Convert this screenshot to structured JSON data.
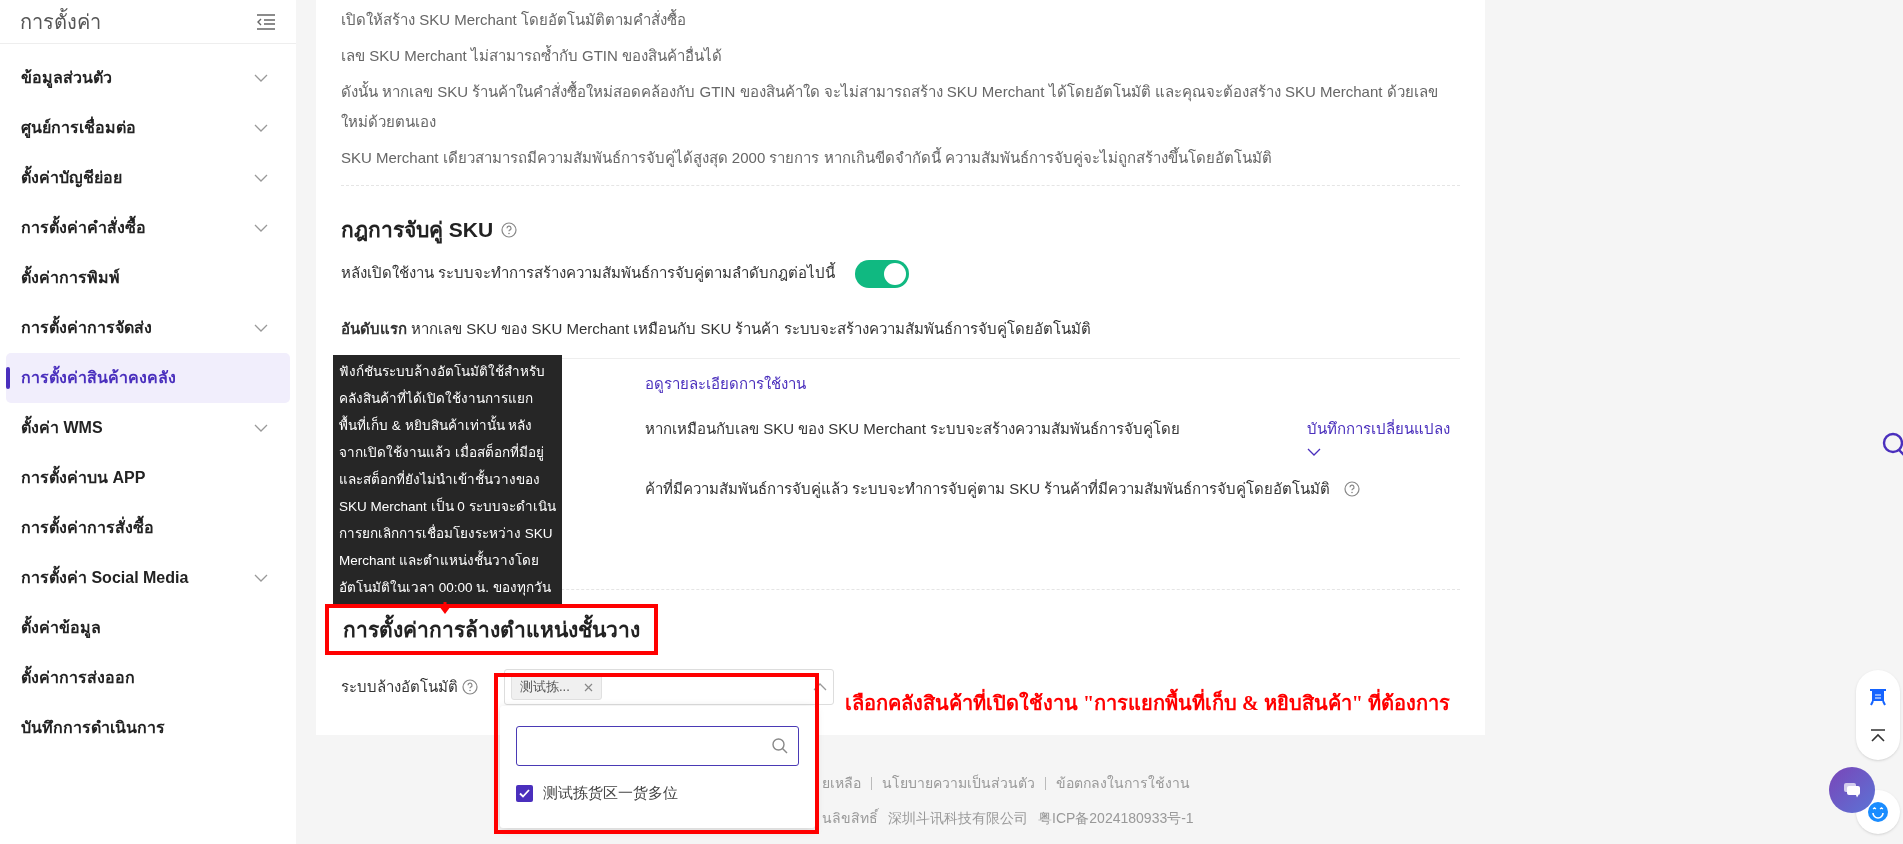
{
  "sidebar": {
    "title": "การตั้งค่า",
    "items": [
      {
        "label": "ข้อมูลส่วนตัว",
        "expandable": true,
        "selected": false
      },
      {
        "label": "ศูนย์การเชื่อมต่อ",
        "expandable": true,
        "selected": false
      },
      {
        "label": "ตั้งค่าบัญชีย่อย",
        "expandable": true,
        "selected": false
      },
      {
        "label": "การตั้งค่าคำสั่งซื้อ",
        "expandable": true,
        "selected": false
      },
      {
        "label": "ตั้งค่าการพิมพ์",
        "expandable": false,
        "selected": false
      },
      {
        "label": "การตั้งค่าการจัดส่ง",
        "expandable": true,
        "selected": false
      },
      {
        "label": "การตั้งค่าสินค้าคงคลัง",
        "expandable": false,
        "selected": true
      },
      {
        "label": "ตั้งค่า WMS",
        "expandable": true,
        "selected": false
      },
      {
        "label": "การตั้งค่าบน APP",
        "expandable": false,
        "selected": false
      },
      {
        "label": "การตั้งค่าการสั่งซื้อ",
        "expandable": false,
        "selected": false
      },
      {
        "label": "การตั้งค่า Social Media",
        "expandable": true,
        "selected": false
      },
      {
        "label": "ตั้งค่าข้อมูล",
        "expandable": false,
        "selected": false
      },
      {
        "label": "ตั้งค่าการส่งออก",
        "expandable": false,
        "selected": false
      },
      {
        "label": "บันทึกการดำเนินการ",
        "expandable": false,
        "selected": false
      }
    ]
  },
  "intro_lines": [
    "เปิดให้สร้าง SKU Merchant โดยอัตโนมัติตามคำสั่งซื้อ",
    "เลข SKU Merchant ไม่สามารถซ้ำกับ GTIN ของสินค้าอื่นได้",
    "ดังนั้น หากเลข SKU ร้านค้าในคำสั่งซื้อใหม่สอดคล้องกับ GTIN ของสินค้าใด จะไม่สามารถสร้าง SKU Merchant ได้โดยอัตโนมัติ และคุณจะต้องสร้าง SKU Merchant ด้วยเลขใหม่ด้วยตนเอง",
    "SKU Merchant เดียวสามารถมีความสัมพันธ์การจับคู่ได้สูงสุด 2000 รายการ หากเกินขีดจำกัดนี้ ความสัมพันธ์การจับคู่จะไม่ถูกสร้างขึ้นโดยอัตโนมัติ"
  ],
  "matching_rules": {
    "title": "กฎการจับคู่ SKU",
    "toggle_label": "หลังเปิดใช้งาน ระบบจะทำการสร้างความสัมพันธ์การจับคู่ตามลำดับกฎต่อไปนี้",
    "toggle_on": true,
    "first_rule": "**อันดับแรก** หากเลข SKU ของ SKU Merchant เหมือนกับ SKU ร้านค้า ระบบจะสร้างความสัมพันธ์การจับคู่โดยอัตโนมัติ",
    "usage_link": "อดูรายละเอียดการใช้งาน",
    "rule_2": "หากเหมือนกับเลข SKU ของ SKU Merchant ระบบจะสร้างความสัมพันธ์การจับคู่โดย",
    "history_link": "บันทึกการเปลี่ยนแปลง",
    "rule_3": "ค้าที่มีความสัมพันธ์การจับคู่แล้ว ระบบจะทำการจับคู่ตาม SKU ร้านค้าที่มีความสัมพันธ์การจับคู่โดยอัตโนมัติ"
  },
  "tooltip": {
    "text": "ฟังก์ชันระบบล้างอัตโนมัติใช้สำหรับคลังสินค้าที่ได้เปิดใช้งานการแยกพื้นที่เก็บ & หยิบสินค้าเท่านั้น หลังจากเปิดใช้งานแล้ว เมื่อสต็อกที่มีอยู่และสต็อกที่ยังไม่นำเข้าชั้นวางของ SKU Merchant เป็น 0 ระบบจะดำเนินการยกเลิกการเชื่อมโยงระหว่าง SKU Merchant และตำแหน่งชั้นวางโดยอัตโนมัติในเวลา 00:00 น. ของทุกวัน"
  },
  "shelf_clearing": {
    "title": "การตั้งค่าการล้างตำแหน่งชั้นวาง",
    "field_label": "ระบบล้างอัตโนมัติ",
    "tags": [
      {
        "label": "测试拣..."
      }
    ],
    "expanded": true,
    "options": [
      {
        "label": "测试拣货区一货多位",
        "checked": true
      }
    ]
  },
  "annotation": "เลือกคลังสินค้าที่เปิดใช้งาน \"การแยกพื้นที่เก็บ & หยิบสินค้า\" ที่ต้องการ",
  "footer": {
    "links": [
      "ยเหลือ",
      "นโยบายความเป็นส่วนตัว",
      "ข้อตกลงในการใช้งาน"
    ],
    "copyright": [
      "นลิขสิทธิ์",
      "深圳斗讯科技有限公司",
      "粤ICP备2024180933号-1"
    ]
  }
}
